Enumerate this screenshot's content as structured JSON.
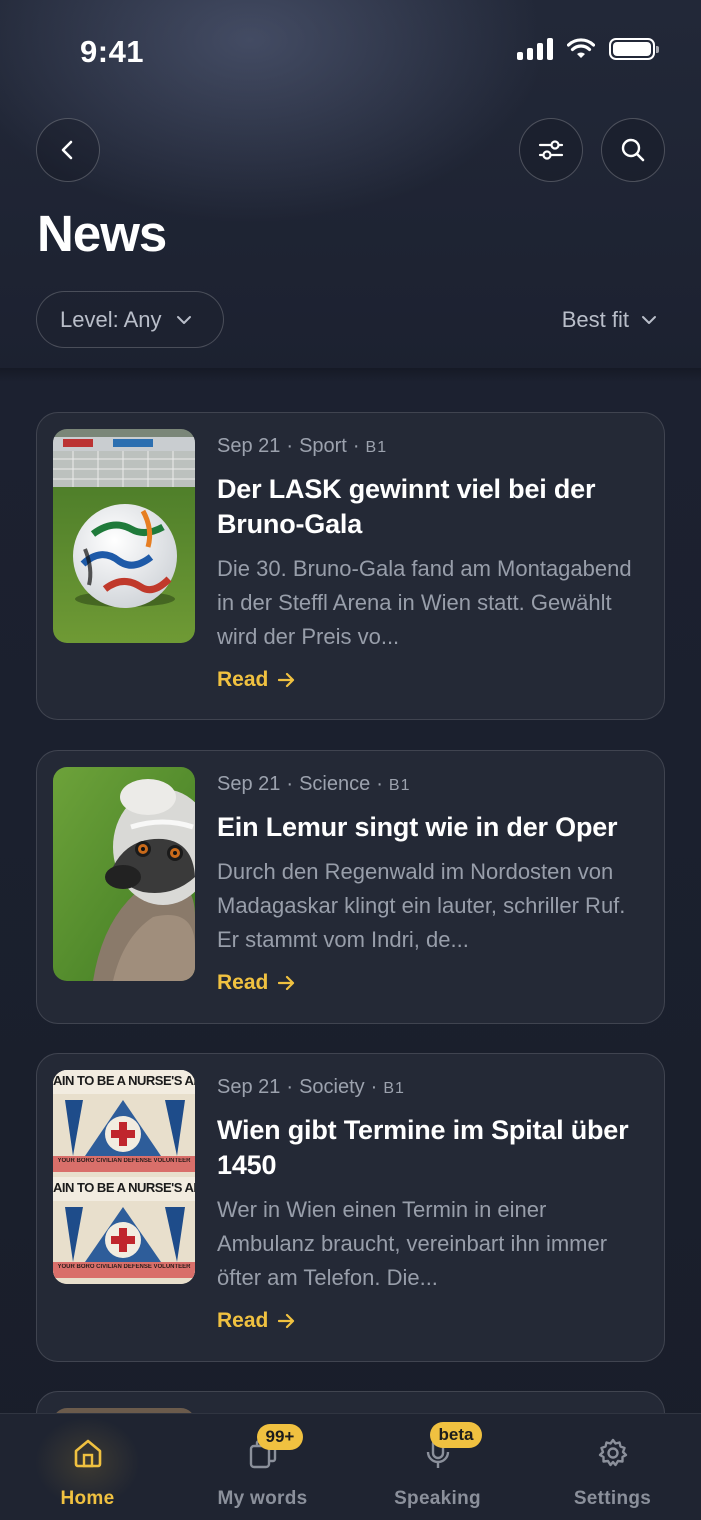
{
  "status_bar": {
    "time": "9:41"
  },
  "header": {
    "title": "News",
    "level_filter": "Level: Any",
    "sort": "Best fit"
  },
  "articles": [
    {
      "date": "Sep 21",
      "category": "Sport",
      "level": "B1",
      "title": "Der LASK gewinnt viel bei der Bruno-Gala",
      "excerpt": "Die 30. Bruno-Gala fand am Montagabend in der Steffl Arena in Wien statt. Gewählt wird der Preis vo...",
      "read_label": "Read"
    },
    {
      "date": "Sep 21",
      "category": "Science",
      "level": "B1",
      "title": "Ein Lemur singt wie in der Oper",
      "excerpt": "Durch den Regenwald im Nordosten von Madagaskar klingt ein lauter, schriller Ruf. Er stammt vom Indri, de...",
      "read_label": "Read"
    },
    {
      "date": "Sep 21",
      "category": "Society",
      "level": "B1",
      "title": "Wien gibt Termine im Spital über 1450",
      "excerpt": "Wer in Wien einen Termin in einer Ambulanz braucht, vereinbart ihn immer öfter am Telefon. Die...",
      "read_label": "Read",
      "poster_text": "AIN TO BE A NURSE'S AI",
      "poster_footer": "YOUR BORO CIVILIAN DEFENSE VOLUNTEER"
    }
  ],
  "tabbar": {
    "tabs": [
      {
        "label": "Home",
        "icon": "home-icon",
        "active": true
      },
      {
        "label": "My words",
        "icon": "cards-icon",
        "badge": "99+"
      },
      {
        "label": "Speaking",
        "icon": "microphone-icon",
        "badge": "beta"
      },
      {
        "label": "Settings",
        "icon": "gear-icon"
      }
    ]
  },
  "colors": {
    "accent": "#f0c140",
    "background": "#1a1f2b",
    "card": "#242936"
  }
}
